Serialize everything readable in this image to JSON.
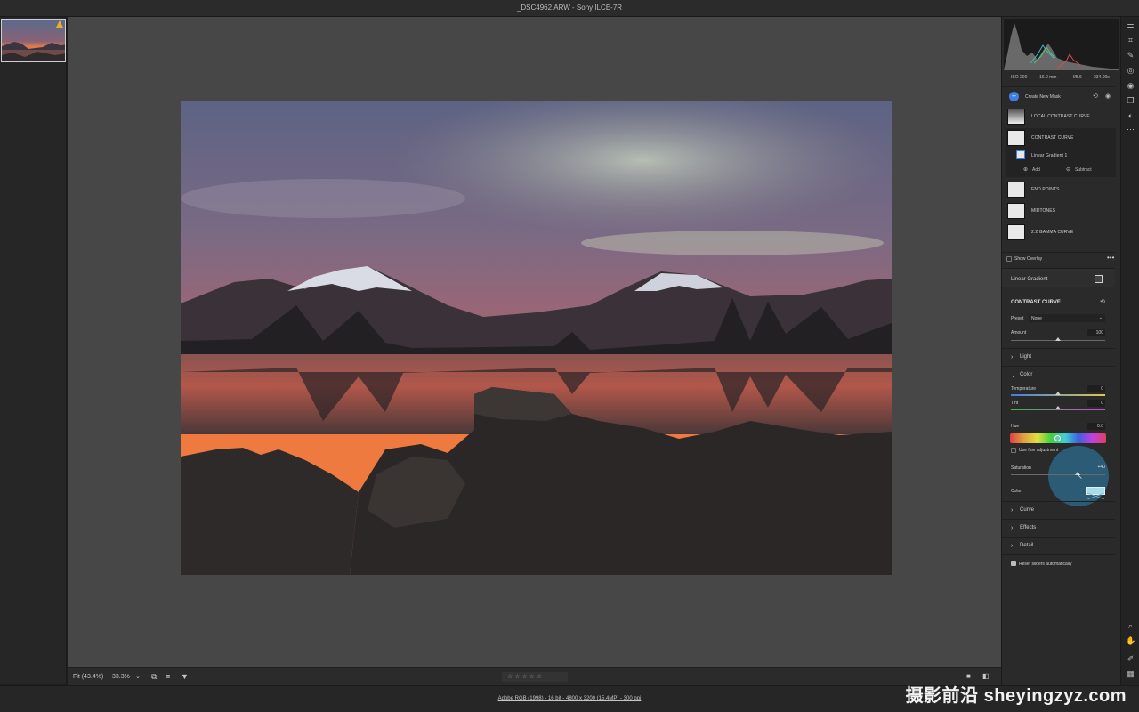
{
  "window": {
    "title": "_DSC4962.ARW  -  Sony ILCE-7R"
  },
  "bottom_bar": {
    "zoom_fit": "Fit (43.4%)",
    "zoom_value": "33.3%",
    "rating": "☆ ☆ ☆ ☆ ☆"
  },
  "status_bar": {
    "info": "Adobe RGB (1998) - 16 bit - 4800 x 3200 (15.4MP) - 300 ppi"
  },
  "exif": {
    "iso": "ISO 200",
    "focal": "16.0 mm",
    "aperture": "f/5.6",
    "shutter": "234.00s"
  },
  "masks": {
    "create_label": "Create New Mask",
    "items": [
      {
        "label": "LOCAL CONTRAST CURVE"
      },
      {
        "label": "CONTRAST CURVE"
      },
      {
        "label": "Linear Gradient 1"
      },
      {
        "label": "END POINTS"
      },
      {
        "label": "MIDTONES"
      },
      {
        "label": "2.2 GAMMA CURVE"
      }
    ],
    "add_label": "Add",
    "subtract_label": "Subtract",
    "show_overlay": "Show Overlay"
  },
  "adjust": {
    "component_label": "Linear Gradient",
    "mask_name": "CONTRAST CURVE",
    "preset_label": "Preset",
    "preset_value": "None",
    "amount_label": "Amount",
    "amount_value": "100",
    "sections": {
      "light": "Light",
      "color": "Color",
      "curve": "Curve",
      "effects": "Effects",
      "detail": "Detail"
    },
    "temperature_label": "Temperature",
    "temperature_value": "0",
    "tint_label": "Tint",
    "tint_value": "0",
    "hue_label": "Hue",
    "hue_value": "0.0",
    "fine_adjust_label": "Use fine adjustment",
    "saturation_label": "Saturation",
    "saturation_value": "+40",
    "color_label": "Color",
    "reset_label": "Reset sliders automatically"
  },
  "colors": {
    "accent": "#3d7fe6",
    "cursor_highlight": "#2d6c8f"
  },
  "watermark": "摄影前沿 sheyingzyz.com"
}
